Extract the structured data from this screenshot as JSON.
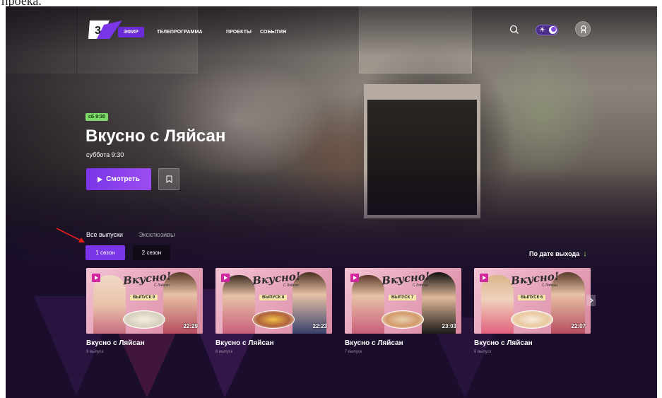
{
  "colors": {
    "accent": "#7a35e8",
    "badge_green": "#7ed96a",
    "bg_dark": "#1b0e2c",
    "play_badge": "#d1279e"
  },
  "top_crop_text": "проека.",
  "nav": {
    "logo": "logo-3-channel",
    "items": [
      {
        "label": "ЭФИР",
        "active": true
      },
      {
        "label": "ТЕЛЕПРОГРАММА",
        "active": false
      },
      {
        "label": "ПРОЕКТЫ",
        "active": false
      },
      {
        "label": "СОБЫТИЯ",
        "active": false
      }
    ],
    "icons": [
      "search-icon",
      "sun-icon",
      "moon-icon",
      "user-icon"
    ]
  },
  "hero": {
    "badge": "сб 9:30",
    "title": "Вкусно с Ляйсан",
    "subtitle": "суббота 9:30",
    "watch_label": "Смотреть",
    "watch_icon": "play-icon",
    "bookmark_icon": "bookmark-icon"
  },
  "tabs": [
    {
      "label": "Все выпуски",
      "active": true
    },
    {
      "label": "Эксклюзивы",
      "active": false
    }
  ],
  "seasons": [
    {
      "label": "1 сезон",
      "active": true
    },
    {
      "label": "2 сезон",
      "active": false
    }
  ],
  "sort": {
    "label": "По дате выхода",
    "icon": "arrow-down-icon"
  },
  "cards": [
    {
      "thumb_logo": "Вкусно!",
      "thumb_sub": "С Ляйсан",
      "thumb_badge": "ВЫПУСК 9",
      "duration": "22:29",
      "title": "Вкусно с Ляйсан",
      "subtitle": "9 выпуск"
    },
    {
      "thumb_logo": "Вкусно!",
      "thumb_sub": "С Ляйсан",
      "thumb_badge": "ВЫПУСК 8",
      "duration": "22:23",
      "title": "Вкусно с Ляйсан",
      "subtitle": "8 выпуск"
    },
    {
      "thumb_logo": "Вкусно!",
      "thumb_sub": "С Ляйсан",
      "thumb_badge": "ВЫПУСК 7",
      "duration": "23:03",
      "title": "Вкусно с Ляйсан",
      "subtitle": "7 выпуск"
    },
    {
      "thumb_logo": "Вкусно!",
      "thumb_sub": "С Ляйсан",
      "thumb_badge": "ВЫПУСК 6",
      "duration": "22:07",
      "title": "Вкусно с Ляйсан",
      "subtitle": "6 выпуск"
    }
  ],
  "carousel_next_icon": "chevron-right-icon"
}
